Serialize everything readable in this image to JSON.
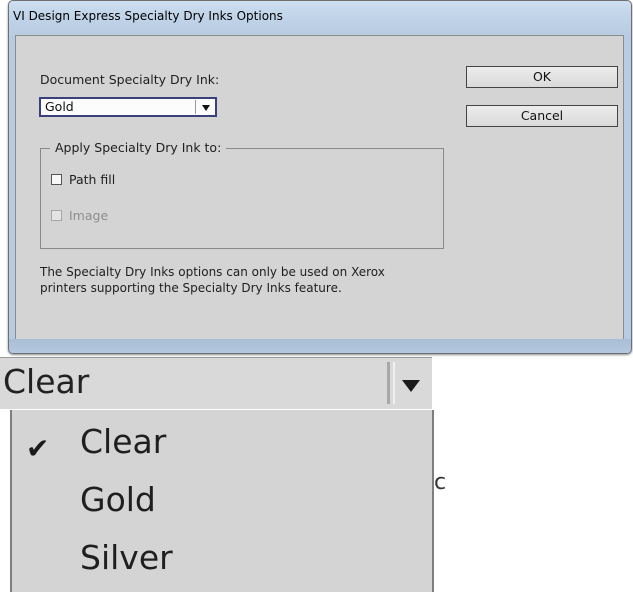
{
  "dialog": {
    "title": "VI Design Express Specialty Dry Inks Options",
    "document_ink_label": "Document Specialty Dry Ink:",
    "document_ink_value": "Gold",
    "ok_label": "OK",
    "cancel_label": "Cancel",
    "apply_group_label": "Apply Specialty Dry Ink to:",
    "path_fill_label": "Path fill",
    "image_label": "Image",
    "note_text": "The Specialty Dry Inks options can only be used on Xerox printers supporting the Specialty Dry Inks feature."
  },
  "zoom_dropdown": {
    "selected_value": "Clear",
    "options": [
      "Clear",
      "Gold",
      "Silver"
    ],
    "checked_index": 0,
    "check_glyph": "✔",
    "cutoff_glyph": "c"
  }
}
